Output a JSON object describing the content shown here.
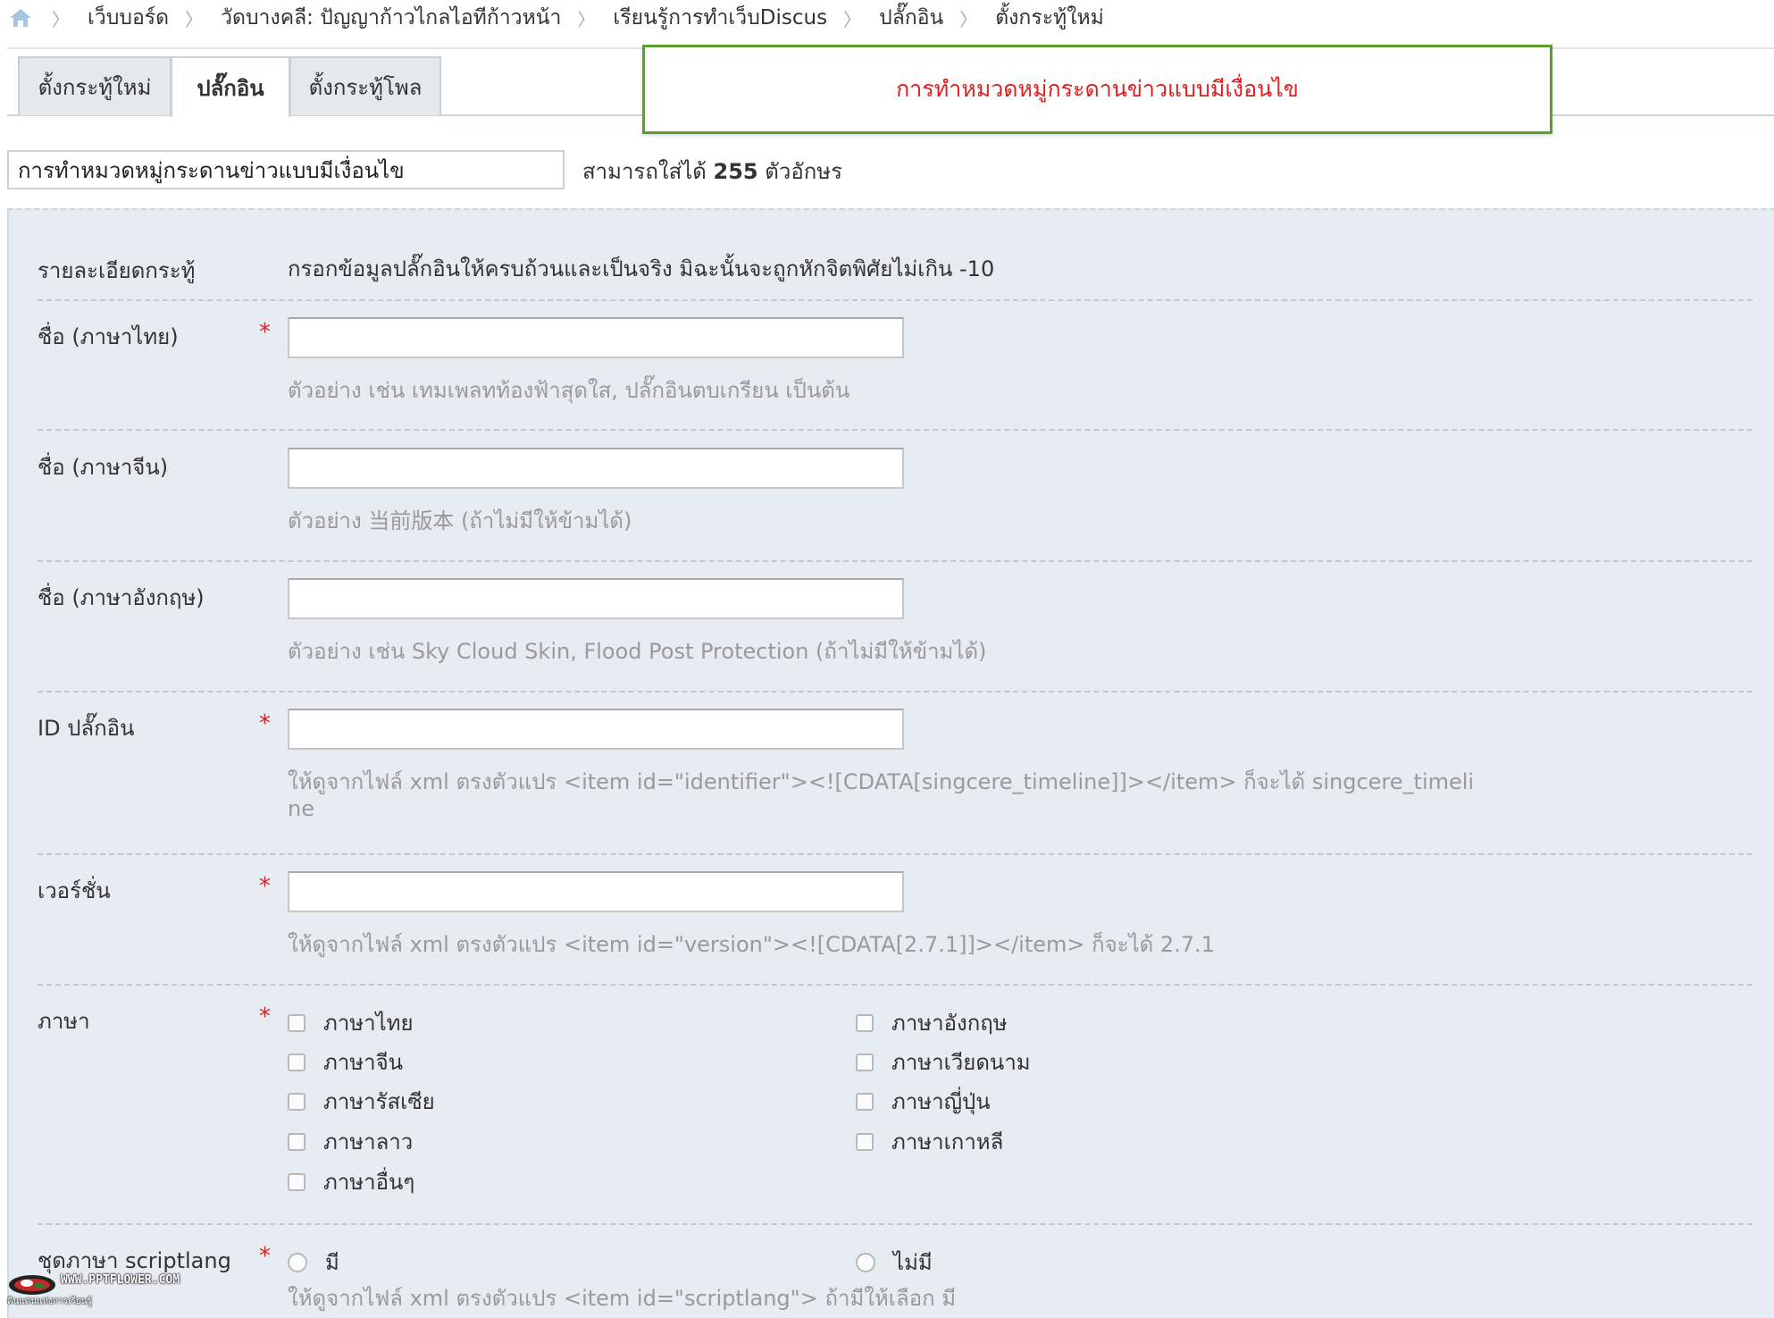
{
  "breadcrumb": {
    "home_icon": "home-icon",
    "items": [
      "เว็บบอร์ด",
      "วัดบางคลี: ปัญญาก้าวไกลไอทีก้าวหน้า",
      "เรียนรู้การทำเว็บDiscus",
      "ปลั๊กอิน",
      "ตั้งกระทู้ใหม่"
    ]
  },
  "tabs": [
    "ตั้งกระทู้ใหม่",
    "ปลั๊กอิน",
    "ตั้งกระทู้โพล"
  ],
  "callout": "การทำหมวดหมู่กระดานข่าวแบบมีเงื่อนไข",
  "subject": {
    "value": "การทำหมวดหมู่กระดานข่าวแบบมีเงื่อนไข",
    "hint_prefix": "สามารถใส่ได้",
    "hint_count": "255",
    "hint_suffix": "ตัวอักษร"
  },
  "form": {
    "detail_label": "รายละเอียดกระทู้",
    "detail_text": "กรอกข้อมูลปลั๊กอินให้ครบถ้วนและเป็นจริง มิฉะนั้นจะถูกหักจิตพิศัยไม่เกิน -10",
    "required_mark": "*",
    "name_th": {
      "label": "ชื่อ (ภาษาไทย)",
      "tip": "ตัวอย่าง เช่น เทมเพลทท้องฟ้าสุดใส, ปลั๊กอินตบเกรียน เป็นต้น"
    },
    "name_cn": {
      "label": "ชื่อ (ภาษาจีน)",
      "tip": "ตัวอย่าง 当前版本 (ถ้าไม่มีให้ข้ามได้)"
    },
    "name_en": {
      "label": "ชื่อ (ภาษาอังกฤษ)",
      "tip": "ตัวอย่าง เช่น Sky Cloud Skin, Flood Post Protection (ถ้าไม่มีให้ข้ามได้)"
    },
    "plugin_id": {
      "label": "ID ปลั๊กอิน",
      "tip_line1": "ให้ดูจากไฟล์ xml ตรงตัวแปร <item id=\"identifier\"><![CDATA[singcere_timeline]]></item> ก็จะได้ singcere_timeli",
      "tip_line2": "ne"
    },
    "version": {
      "label": "เวอร์ชั่น",
      "tip": "ให้ดูจากไฟล์ xml ตรงตัวแปร <item id=\"version\"><![CDATA[2.7.1]]></item> ก็จะได้ 2.7.1"
    },
    "language": {
      "label": "ภาษา",
      "options_left": [
        "ภาษาไทย",
        "ภาษาจีน",
        "ภาษารัสเซีย",
        "ภาษาลาว",
        "ภาษาอื่นๆ"
      ],
      "options_right": [
        "ภาษาอังกฤษ",
        "ภาษาเวียดนาม",
        "ภาษาญี่ปุ่น",
        "ภาษาเกาหลี"
      ]
    },
    "scriptlang": {
      "label": "ชุดภาษา scriptlang",
      "option_yes": "มี",
      "option_no": "ไม่มี",
      "tip": "ให้ดูจากไฟล์ xml ตรงตัวแปร <item id=\"scriptlang\"> ถ้ามีให้เลือก มี"
    }
  },
  "watermark": {
    "line1": "WWW.PPTFLOWER.COM",
    "line2": "ดินแดนแห่งการเรียนรู้"
  }
}
